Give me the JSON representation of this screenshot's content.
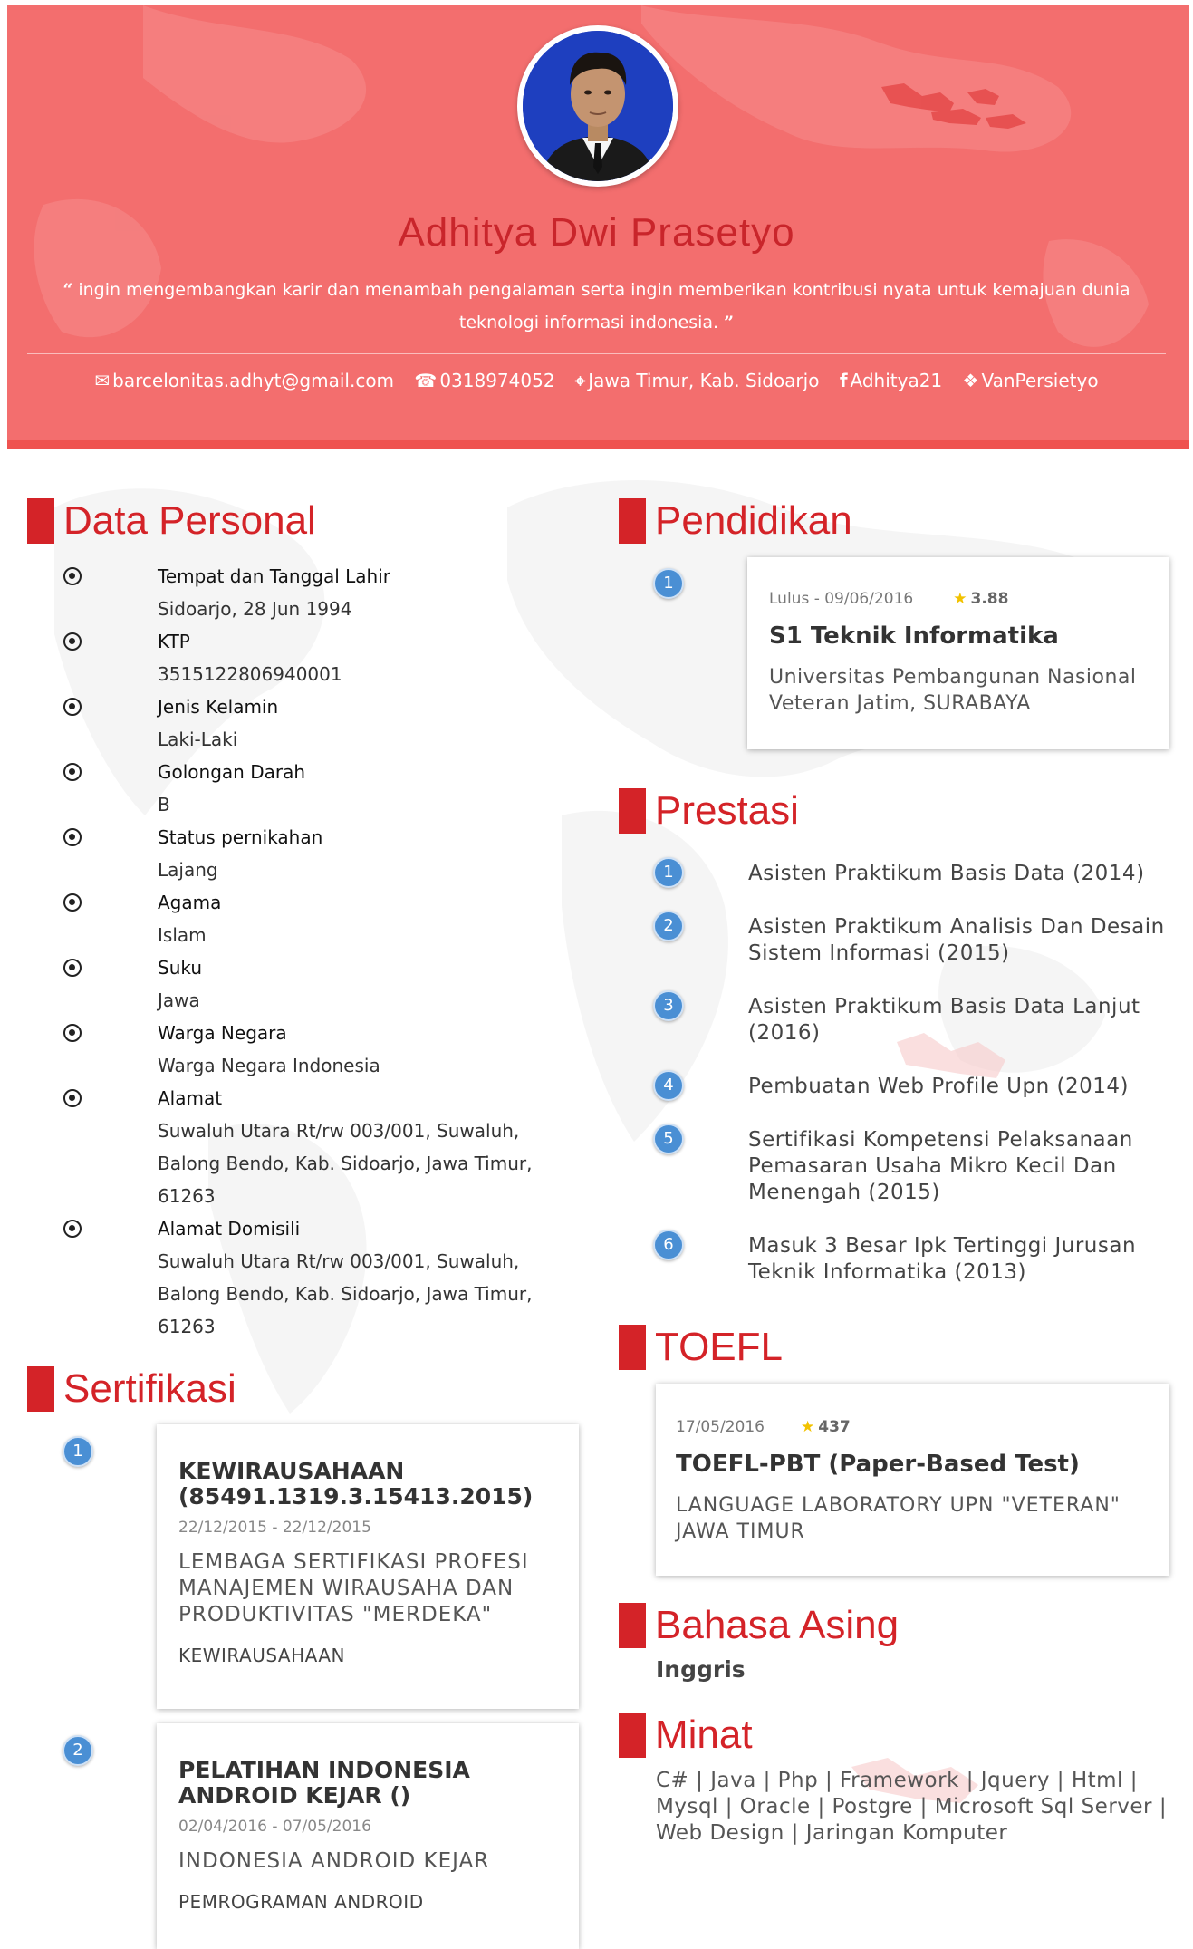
{
  "profile": {
    "name": "Adhitya Dwi Prasetyo",
    "motto_open": "“",
    "motto": "ingin mengembangkan karir dan menambah pengalaman serta ingin memberikan kontribusi nyata untuk kemajuan dunia teknologi informasi indonesia.",
    "motto_close": "”",
    "contacts": [
      {
        "icon": "envelope-icon",
        "glyph": "✉",
        "text": "barcelonitas.adhyt@gmail.com"
      },
      {
        "icon": "phone-icon",
        "glyph": "☎",
        "text": "0318974052"
      },
      {
        "icon": "map-marker-icon",
        "glyph": "⌖",
        "text": "Jawa Timur, Kab. Sidoarjo"
      },
      {
        "icon": "facebook-icon",
        "glyph": "f",
        "text": "Adhitya21"
      },
      {
        "icon": "twitter-icon",
        "glyph": "❖",
        "text": "VanPersietyo"
      }
    ]
  },
  "sections": {
    "data_personal": "Data Personal",
    "sertifikasi": "Sertifikasi",
    "pendidikan": "Pendidikan",
    "prestasi": "Prestasi",
    "toefl": "TOEFL",
    "bahasa_asing": "Bahasa Asing",
    "minat": "Minat"
  },
  "personal": [
    {
      "label": "Tempat dan Tanggal Lahir",
      "value": "Sidoarjo, 28 Jun 1994"
    },
    {
      "label": "KTP",
      "value": "3515122806940001"
    },
    {
      "label": "Jenis Kelamin",
      "value": "Laki-Laki"
    },
    {
      "label": "Golongan Darah",
      "value": "B"
    },
    {
      "label": "Status pernikahan",
      "value": "Lajang"
    },
    {
      "label": "Agama",
      "value": "Islam"
    },
    {
      "label": "Suku",
      "value": "Jawa"
    },
    {
      "label": "Warga Negara",
      "value": "Warga Negara Indonesia"
    },
    {
      "label": "Alamat",
      "value": "Suwaluh Utara Rt/rw 003/001, Suwaluh, Balong Bendo, Kab. Sidoarjo, Jawa Timur, 61263"
    },
    {
      "label": "Alamat Domisili",
      "value": "Suwaluh Utara Rt/rw 003/001, Suwaluh, Balong Bendo, Kab. Sidoarjo, Jawa Timur, 61263"
    }
  ],
  "certifications": [
    {
      "num": "1",
      "title": "KEWIRAUSAHAAN (85491.1319.3.15413.2015)",
      "dates": "22/12/2015 - 22/12/2015",
      "org": "LEMBAGA SERTIFIKASI PROFESI MANAJEMEN WIRAUSAHA DAN PRODUKTIVITAS \"MERDEKA\"",
      "category": "KEWIRAUSAHAAN"
    },
    {
      "num": "2",
      "title": "PELATIHAN INDONESIA ANDROID KEJAR ()",
      "dates": "02/04/2016 - 07/05/2016",
      "org": "INDONESIA ANDROID KEJAR",
      "category": "PEMROGRAMAN ANDROID"
    }
  ],
  "education": [
    {
      "num": "1",
      "graduated": "Lulus - 09/06/2016",
      "gpa": "3.88",
      "degree": "S1 Teknik Informatika",
      "school": "Universitas Pembangunan Nasional Veteran Jatim, SURABAYA"
    }
  ],
  "achievements": [
    {
      "num": "1",
      "text": "Asisten Praktikum Basis Data (2014)"
    },
    {
      "num": "2",
      "text": "Asisten Praktikum Analisis Dan Desain Sistem Informasi (2015)"
    },
    {
      "num": "3",
      "text": "Asisten Praktikum Basis Data Lanjut (2016)"
    },
    {
      "num": "4",
      "text": "Pembuatan Web Profile Upn (2014)"
    },
    {
      "num": "5",
      "text": "Sertifikasi Kompetensi Pelaksanaan Pemasaran Usaha Mikro Kecil Dan Menengah (2015)"
    },
    {
      "num": "6",
      "text": "Masuk 3 Besar Ipk Tertinggi Jurusan Teknik Informatika (2013)"
    }
  ],
  "toefl": {
    "date": "17/05/2016",
    "score": "437",
    "test": "TOEFL-PBT (Paper-Based Test)",
    "institution": "LANGUAGE LABORATORY UPN \"VETERAN\" JAWA TIMUR"
  },
  "languages": "Inggris",
  "interests": "C# | Java | Php | Framework | Jquery | Html | Mysql | Oracle | Postgre | Microsoft Sql Server | Web Design | Jaringan Komputer",
  "colors": {
    "header_bg": "#f36e6e",
    "accent_red": "#d42328",
    "name_red": "#c9252b",
    "bubble_blue": "#4a8fd4"
  }
}
